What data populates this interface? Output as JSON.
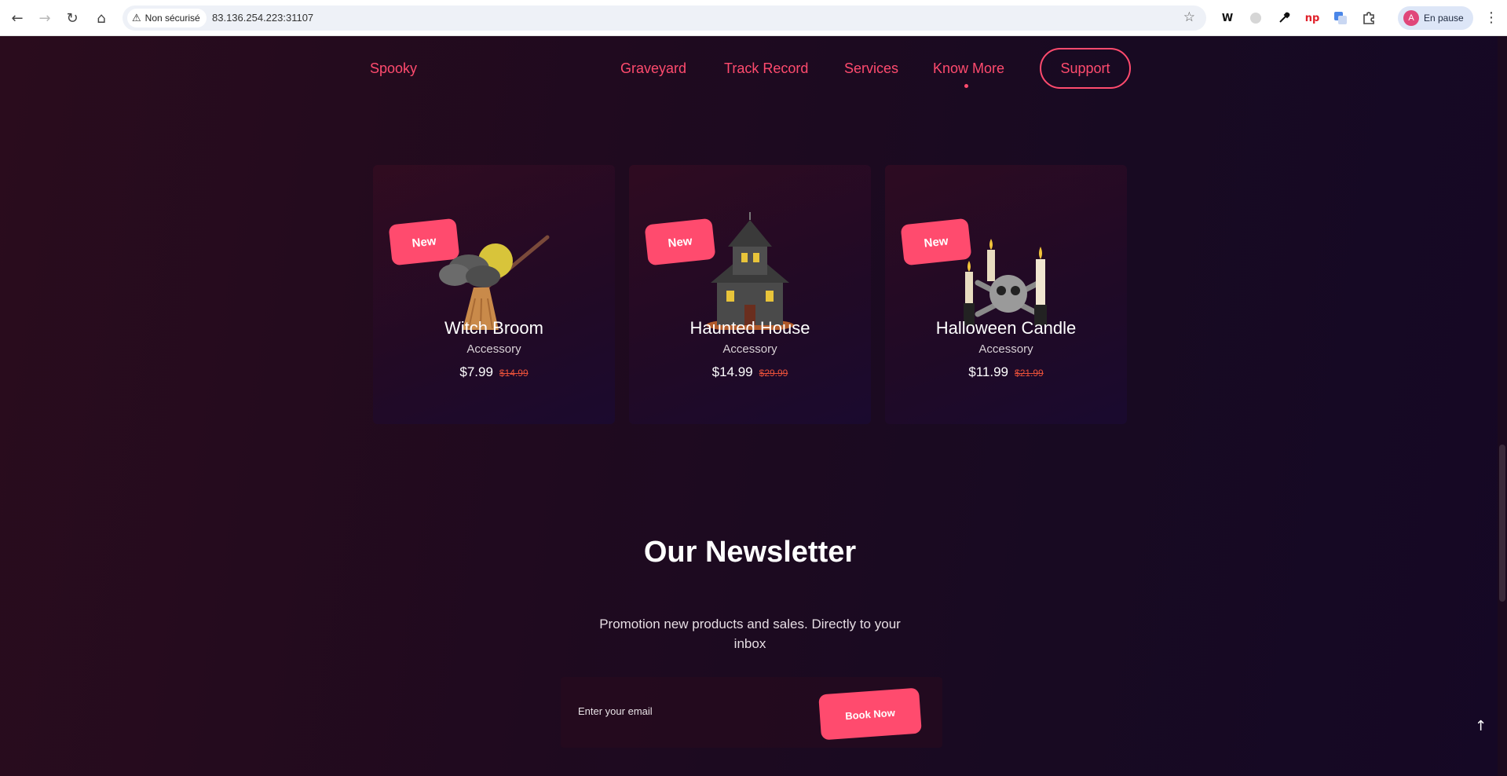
{
  "browser": {
    "security_label": "Non sécurisé",
    "url": "83.136.254.223:31107",
    "profile_label": "En pause",
    "profile_initial": "A",
    "extensions": [
      "W",
      "np"
    ]
  },
  "site": {
    "logo": "Spooky",
    "nav": [
      "Graveyard",
      "Track Record",
      "Services",
      "Know More"
    ],
    "support_label": "Support",
    "accent_color": "#ff4b6e"
  },
  "products": [
    {
      "badge": "New",
      "name": "Witch Broom",
      "category": "Accessory",
      "price": "$7.99",
      "old_price": "$14.99",
      "icon": "witch-broom-icon"
    },
    {
      "badge": "New",
      "name": "Haunted House",
      "category": "Accessory",
      "price": "$14.99",
      "old_price": "$29.99",
      "icon": "haunted-house-icon"
    },
    {
      "badge": "New",
      "name": "Halloween Candle",
      "category": "Accessory",
      "price": "$11.99",
      "old_price": "$21.99",
      "icon": "halloween-candle-icon"
    }
  ],
  "newsletter": {
    "title": "Our Newsletter",
    "text": "Promotion new products and sales. Directly to your inbox",
    "email_placeholder": "Enter your email",
    "button_label": "Book Now"
  },
  "back_to_top_icon": "arrow-up-icon"
}
